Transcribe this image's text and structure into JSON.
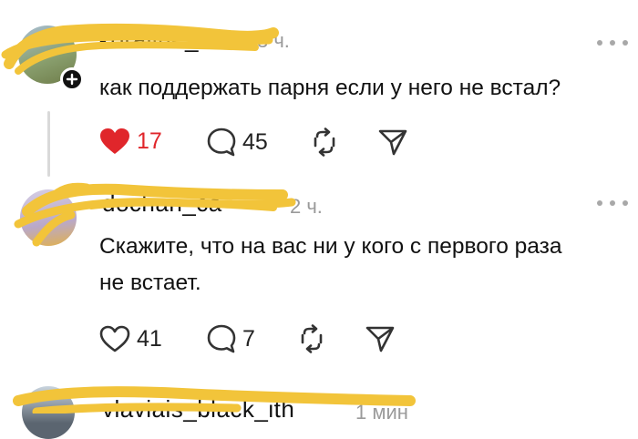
{
  "colors": {
    "accent_red": "#e0262b",
    "scribble": "#f2c43a",
    "icon_gray": "#333333",
    "meta_gray": "#9a9a9a"
  },
  "comments": [
    {
      "username": "koraline_",
      "time": "3 ч.",
      "text": "как поддержать парня если у него не встал?",
      "likes": "17",
      "liked": true,
      "replies": "45"
    },
    {
      "username": "dochan_ca",
      "time": "2 ч.",
      "text_line1": "Скажите, что на вас ни у кого с первого раза",
      "text_line2": "не встает.",
      "likes": "41",
      "liked": false,
      "replies": "7"
    },
    {
      "username": "vlaviais_black_ith",
      "time": "1 мин"
    }
  ],
  "icons": [
    "plus-badge-icon",
    "heart-icon",
    "comment-bubble-icon",
    "repost-icon",
    "send-icon",
    "more-icon"
  ]
}
